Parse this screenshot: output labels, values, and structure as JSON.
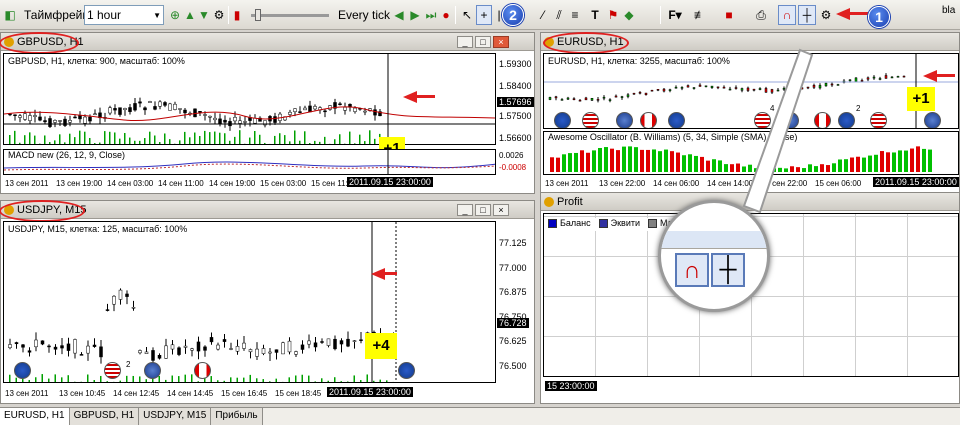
{
  "toolbar": {
    "timeframe_label": "Таймфрейм:",
    "timeframe_value": "1 hour",
    "tick_mode": "Every tick",
    "edge_label": "bla",
    "callout_1": "1",
    "callout_2": "2"
  },
  "windows": {
    "gbpusd": {
      "title": "GBPUSD, H1",
      "info": "GBPUSD, H1, клетка: 900, масштаб: 100%",
      "prices": [
        "1.59300",
        "1.58400",
        "1.57696",
        "1.57500",
        "1.56600"
      ],
      "current_price": "1.57696",
      "indicator": "MACD new (26, 12, 9, Close)",
      "ind_values": [
        "0.0026",
        "-0.0008"
      ],
      "dates": [
        "13 сен 2011",
        "13 сен 19:00",
        "14 сен 03:00",
        "14 сен 11:00",
        "14 сен 19:00",
        "15 сен 03:00",
        "15 сен 11:"
      ],
      "cursor_time": "2011.09.15 23:00:00",
      "badge": "+1"
    },
    "eurusd": {
      "title": "EURUSD, H1",
      "info": "EURUSD, H1, клетка: 3255, масштаб: 100%",
      "indicator": "Awesome Oscillator (B. Williams) (5, 34, Simple (SMA), Close)",
      "dates": [
        "13 сен 2011",
        "13 сен 22:00",
        "14 сен 06:00",
        "14 сен 14:00",
        "14 сен 22:00",
        "15 сен 06:00"
      ],
      "cursor_time": "2011.09.15 23:00:00",
      "badge": "+1",
      "flag_note_1": "4",
      "flag_note_2": "2"
    },
    "usdjpy": {
      "title": "USDJPY, M15",
      "info": "USDJPY, M15, клетка: 125, масштаб: 100%",
      "prices": [
        "77.125",
        "77.000",
        "76.875",
        "76.750",
        "76.625",
        "76.500"
      ],
      "current_price": "76.728",
      "dates": [
        "13 сен 2011",
        "13 сен 10:45",
        "14 сен 12:45",
        "14 сен 14:45",
        "15 сен 16:45",
        "15 сен 18:45"
      ],
      "cursor_time": "2011.09.15 23:00:00",
      "badge": "+4",
      "flag_note": "2"
    },
    "profit": {
      "title": "Profit",
      "legend": [
        "Баланс",
        "Эквити",
        "Маржа"
      ],
      "legend_colors": [
        "#0000c0",
        "#3030a0",
        "#808080"
      ],
      "cursor_time": "15 23:00:00"
    }
  },
  "tabs": [
    {
      "label": "EURUSD, H1",
      "active": true
    },
    {
      "label": "GBPUSD, H1",
      "active": false
    },
    {
      "label": "USDJPY, M15",
      "active": false
    },
    {
      "label": "Прибыль",
      "active": false
    }
  ],
  "colors": {
    "annotation": "#e02020",
    "bull": "#00b000",
    "bear": "#e00000",
    "highlight": "#ffff00"
  }
}
